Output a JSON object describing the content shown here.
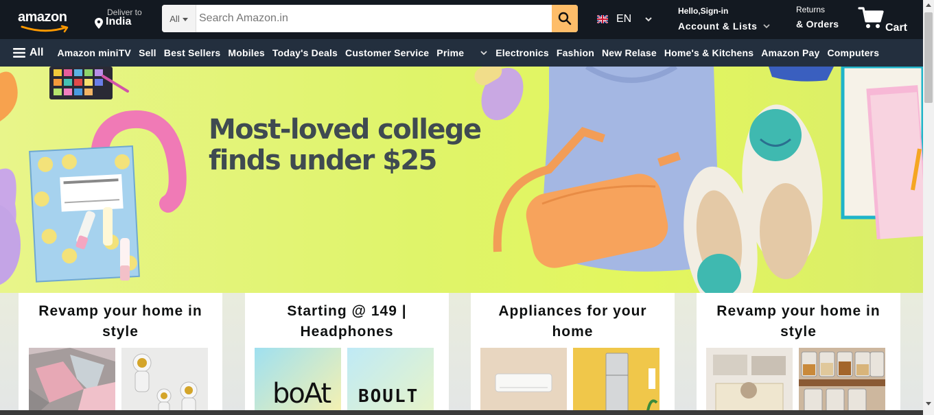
{
  "header": {
    "logo_text": "amazon",
    "deliver_to_label": "Deliver to",
    "deliver_to_location": "India",
    "search_category": "All",
    "search_placeholder": "Search Amazon.in",
    "language": "EN",
    "account_greeting": "Hello,Sign-in",
    "account_label": "Account & Lists",
    "returns_label": "Returns",
    "orders_label": "& Orders",
    "cart_label": "Cart"
  },
  "subnav": {
    "all_label": "All",
    "items": [
      "Amazon miniTV",
      "Sell",
      "Best Sellers",
      "Mobiles",
      "Today's Deals",
      "Customer Service",
      "Prime",
      "Electronics",
      "Fashion",
      "New Relase",
      "Home's & Kitchens",
      "Amazon Pay",
      "Computers"
    ]
  },
  "hero": {
    "headline_line1": "Most-loved college",
    "headline_line2": "finds under $25"
  },
  "cards": [
    {
      "title": "Revamp your home in style",
      "images": [
        "patterned-rug",
        "astronaut-figurines"
      ]
    },
    {
      "title": "Starting @ 149 | Headphones",
      "images": [
        "boat-logo",
        "boult-logo"
      ]
    },
    {
      "title": "Appliances for your home",
      "images": [
        "air-conditioner",
        "refrigerator"
      ]
    },
    {
      "title": "Revamp your home in style",
      "images": [
        "storage-baskets",
        "glass-jars"
      ]
    }
  ],
  "brand_text": {
    "boat": "boAt",
    "boult": "BOULT"
  },
  "colors": {
    "nav_bg": "#131921",
    "subnav_bg": "#232f3e",
    "search_button": "#febd69",
    "accent": "#ff9900",
    "hero_bg": "#e1f564",
    "hero_text": "#3f4a51"
  }
}
